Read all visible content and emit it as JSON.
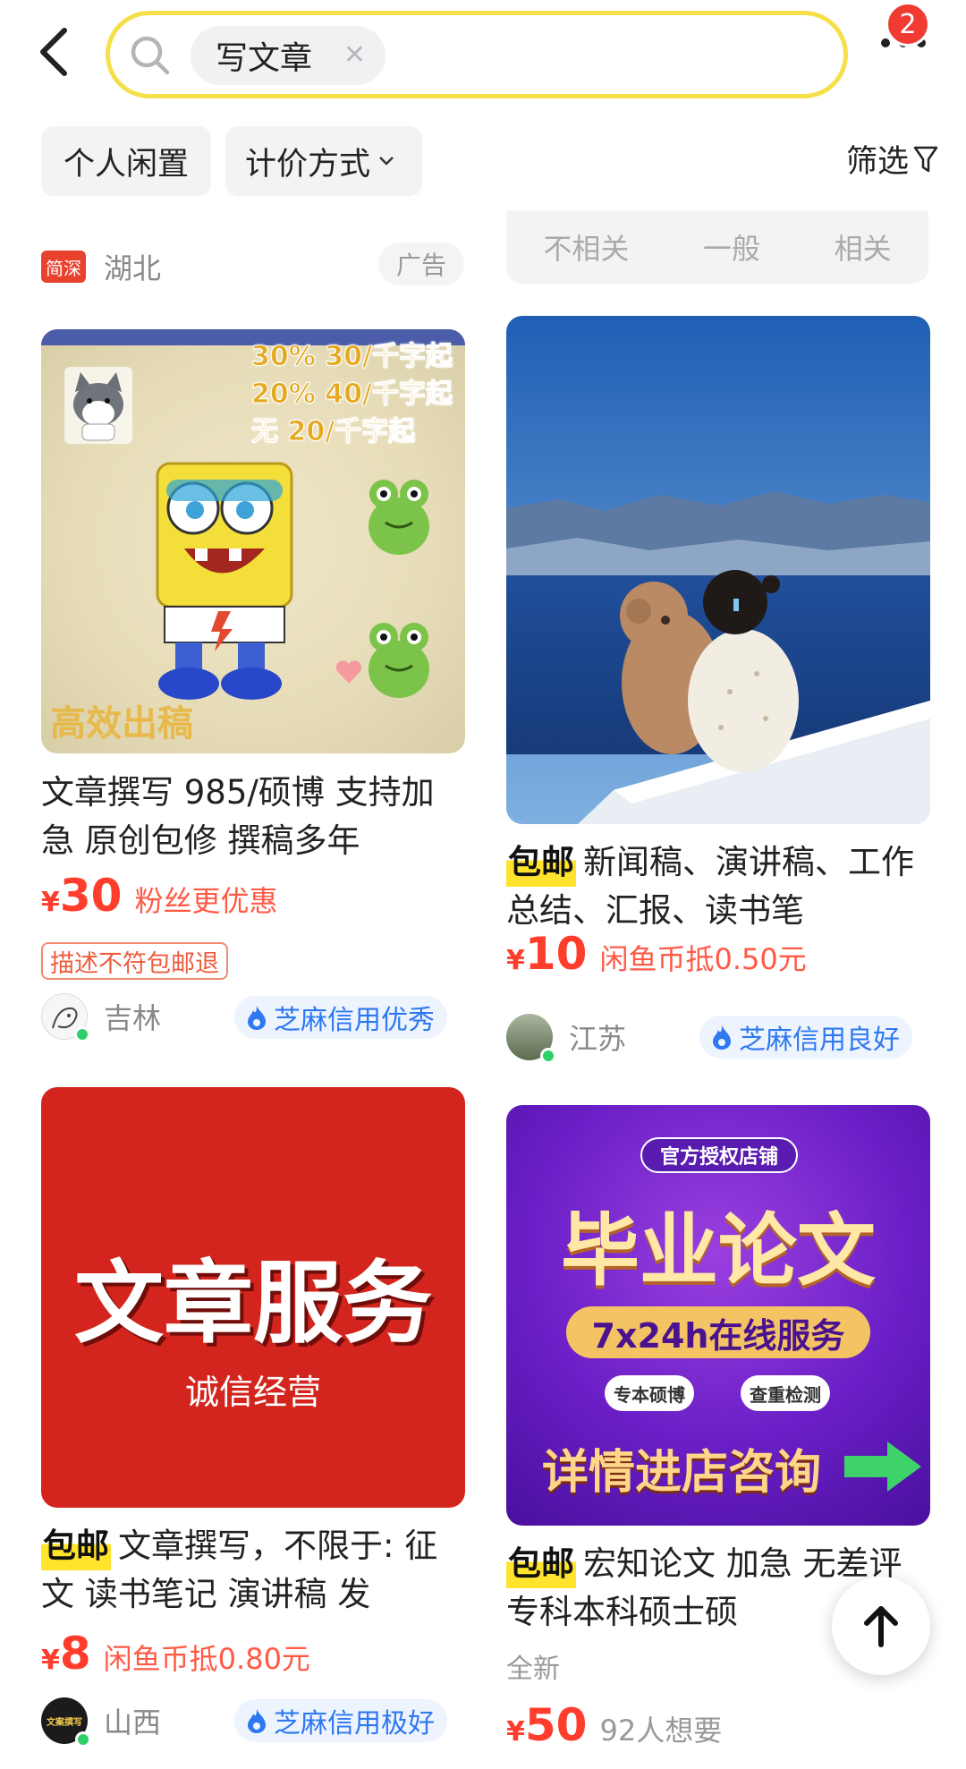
{
  "header": {
    "search_chip": "写文章",
    "badge_count": "2"
  },
  "filters": {
    "pill_1": "个人闲置",
    "pill_2": "计价方式",
    "filter_label": "筛选"
  },
  "partial_top": {
    "left_location_tag": "简深",
    "left_location": "湖北",
    "left_ad": "广告",
    "relevance_options": [
      "不相关",
      "一般",
      "相关"
    ]
  },
  "cards": [
    {
      "title": "文章撰写   985/硕博  支持加急   原创包修  撰稿多年",
      "price_symbol": "¥",
      "price": "30",
      "price_extra": "粉丝更优惠",
      "promise_tag": "描述不符包邮退",
      "location": "吉林",
      "credit": "芝麻信用优秀",
      "image": {
        "pricing_lines": [
          "30%  30/千字起",
          "20%  40/千字起",
          "无    20/千字起"
        ],
        "caption": "高效出稿"
      }
    },
    {
      "tag": "包邮",
      "title": "新闻稿、演讲稿、工作总结、汇报、读书笔",
      "price_symbol": "¥",
      "price": "10",
      "price_extra": "闲鱼币抵0.50元",
      "location": "江苏",
      "credit": "芝麻信用良好"
    },
    {
      "tag": "包邮",
      "title": "文章撰写，不限于: 征文  读书笔记  演讲稿  发",
      "price_symbol": "¥",
      "price": "8",
      "price_extra": "闲鱼币抵0.80元",
      "location": "山西",
      "credit": "芝麻信用极好",
      "image": {
        "headline": "文章服务",
        "subline": "诚信经营"
      },
      "avatar_text": "文案撰写"
    },
    {
      "tag": "包邮",
      "title": "宏知论文  加急  无差评专科本科硕士硕",
      "condition": "全新",
      "price_symbol": "¥",
      "price": "50",
      "price_want": "92人想要",
      "image": {
        "top_badge": "官方授权店铺",
        "headline": "毕业论文",
        "service_line": "7x24h在线服务",
        "chip_1": "专本硕博",
        "chip_2": "查重检测",
        "cta": "详情进店咨询"
      }
    }
  ],
  "colors": {
    "search_border": "#f5e04a",
    "price_red": "#ff3d2d",
    "credit_blue": "#2e78f0",
    "tag_yellow": "#ffe32c",
    "badge_red": "#ef3b32"
  }
}
